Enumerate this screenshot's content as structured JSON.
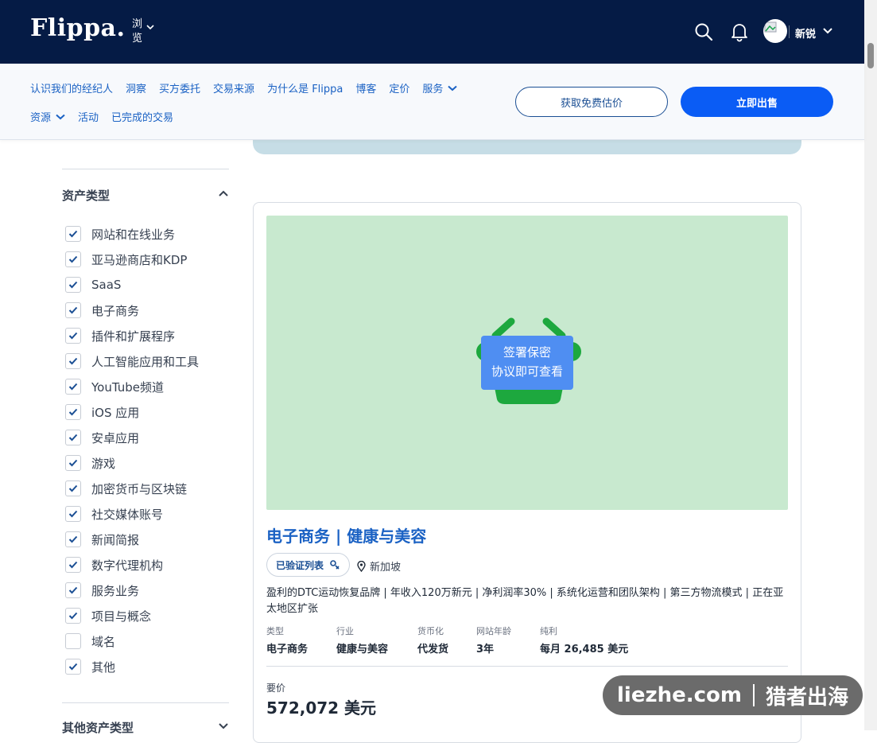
{
  "header": {
    "logo": "Flippa.",
    "browse_label": "浏览",
    "user_name": "新锐",
    "icons": [
      "search-icon",
      "bell-icon",
      "avatar",
      "chevron-down-icon"
    ]
  },
  "subnav": {
    "links_row1": [
      "认识我们的经纪人",
      "洞察",
      "买方委托",
      "交易来源",
      "为什么是 Flippa",
      "博客",
      "定价",
      "服务"
    ],
    "links_row2": [
      "资源",
      "活动",
      "已完成的交易"
    ],
    "cta_outline": "获取免费估价",
    "cta_primary": "立即出售"
  },
  "sidebar": {
    "asset_type_title": "资产类型",
    "filters": [
      {
        "label": "网站和在线业务",
        "checked": true
      },
      {
        "label": "亚马逊商店和KDP",
        "checked": true
      },
      {
        "label": "SaaS",
        "checked": true
      },
      {
        "label": "电子商务",
        "checked": true
      },
      {
        "label": "插件和扩展程序",
        "checked": true
      },
      {
        "label": "人工智能应用和工具",
        "checked": true
      },
      {
        "label": "YouTube频道",
        "checked": true
      },
      {
        "label": "iOS 应用",
        "checked": true
      },
      {
        "label": "安卓应用",
        "checked": true
      },
      {
        "label": "游戏",
        "checked": true
      },
      {
        "label": "加密货币与区块链",
        "checked": true
      },
      {
        "label": "社交媒体账号",
        "checked": true
      },
      {
        "label": "新闻简报",
        "checked": true
      },
      {
        "label": "数字代理机构",
        "checked": true
      },
      {
        "label": "服务业务",
        "checked": true
      },
      {
        "label": "项目与概念",
        "checked": true
      },
      {
        "label": "域名",
        "checked": false
      },
      {
        "label": "其他",
        "checked": true
      }
    ],
    "other_asset_title": "其他资产类型"
  },
  "listing": {
    "nda_line1": "签署保密",
    "nda_line2": "协议即可查看",
    "title": "电子商务 | 健康与美容",
    "verified_label": "已验证列表",
    "location": "新加坡",
    "description": "盈利的DTC运动恢复品牌 | 年收入120万新元 | 净利润率30% | 系统化运营和团队架构 | 第三方物流模式 | 正在亚太地区扩张",
    "meta": [
      {
        "label": "类型",
        "value": "电子商务"
      },
      {
        "label": "行业",
        "value": "健康与美容"
      },
      {
        "label": "货币化",
        "value": "代发货"
      },
      {
        "label": "网站年龄",
        "value": "3年"
      },
      {
        "label": "纯利",
        "value": "每月 26,485 美元"
      }
    ],
    "price_label": "要价",
    "price_value": "572,072 美元"
  },
  "watermark": {
    "left": "liezhe.com",
    "right": "猎者出海"
  },
  "colors": {
    "header_bg": "#051b45",
    "link_blue": "#1b62c4",
    "primary_button": "#0a5cf5",
    "image_bg": "#c8e9cf",
    "basket_green": "#1da83e",
    "nda_badge": "#4f8ef2"
  }
}
